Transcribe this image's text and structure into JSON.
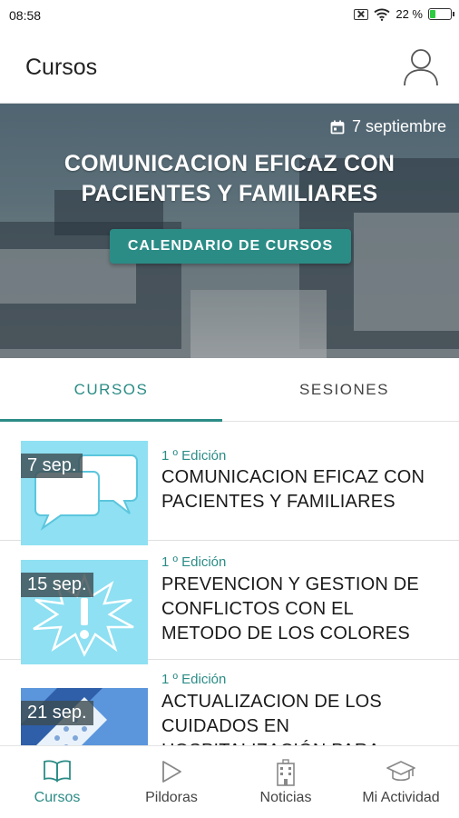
{
  "status_bar": {
    "time": "08:58",
    "battery": "22 %"
  },
  "app_bar": {
    "title": "Cursos"
  },
  "hero": {
    "date": "7 septiembre",
    "title": "COMUNICACION EFICAZ CON PACIENTES Y FAMILIARES",
    "button_label": "CALENDARIO DE CURSOS"
  },
  "tabs": [
    {
      "label": "CURSOS",
      "active": true
    },
    {
      "label": "SESIONES",
      "active": false
    }
  ],
  "courses": [
    {
      "date": "7 sep.",
      "edition": "1 º Edición",
      "title": "COMUNICACION EFICAZ CON PACIENTES Y FAMILIARES"
    },
    {
      "date": "15 sep.",
      "edition": "1 º Edición",
      "title": "PREVENCION Y GESTION DE CONFLICTOS CON EL METODO DE LOS COLORES"
    },
    {
      "date": "21 sep.",
      "edition": "1 º Edición",
      "title": "ACTUALIZACION DE LOS CUIDADOS EN HOSPITALIZACIÓN PARA"
    }
  ],
  "bottom_nav": [
    {
      "label": "Cursos",
      "icon": "book-icon",
      "active": true
    },
    {
      "label": "Pildoras",
      "icon": "play-icon",
      "active": false
    },
    {
      "label": "Noticias",
      "icon": "building-icon",
      "active": false
    },
    {
      "label": "Mi Actividad",
      "icon": "graduation-cap-icon",
      "active": false
    }
  ],
  "colors": {
    "accent": "#2b8c86",
    "thumb_bg": "#8ee0f2"
  }
}
